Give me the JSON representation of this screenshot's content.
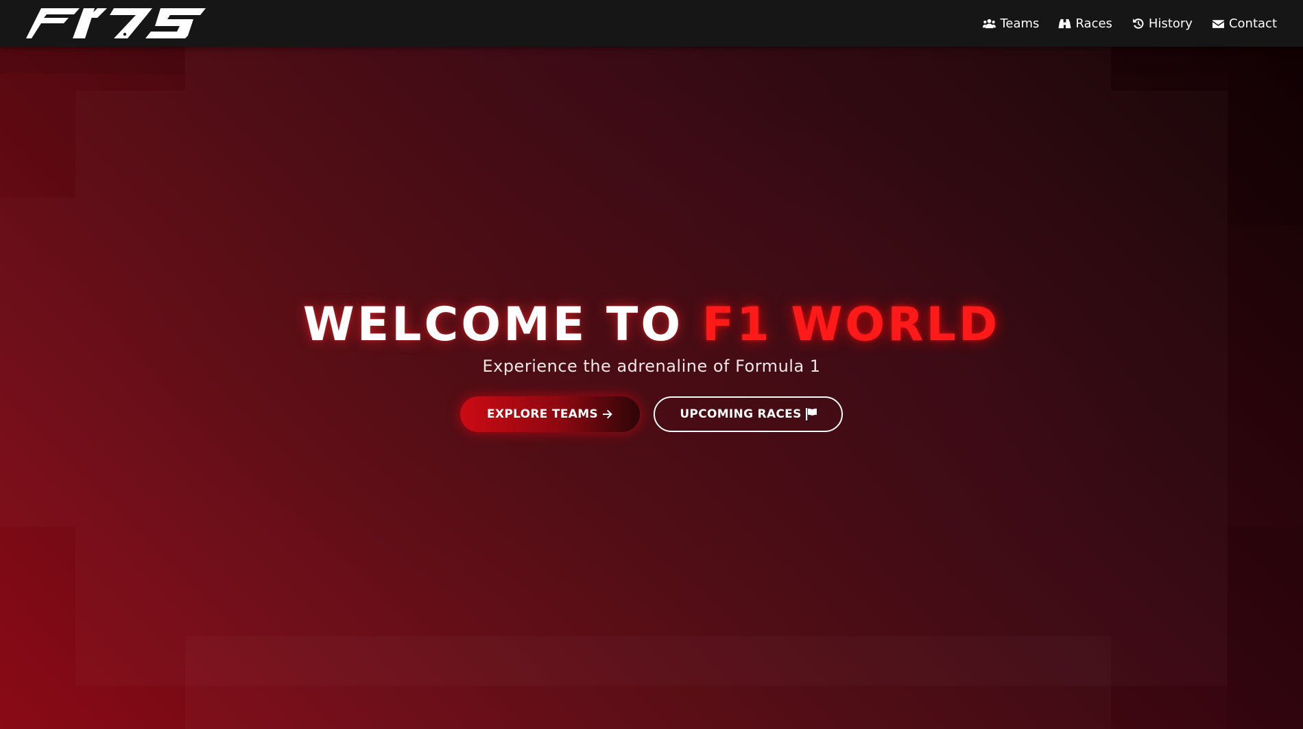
{
  "navbar": {
    "logo_text": "F1 75",
    "links": [
      {
        "label": "Teams",
        "icon": "users-icon"
      },
      {
        "label": "Races",
        "icon": "binoculars-icon"
      },
      {
        "label": "History",
        "icon": "history-icon"
      },
      {
        "label": "Contact",
        "icon": "envelope-icon"
      }
    ]
  },
  "hero": {
    "title_main": "WELCOME TO ",
    "title_accent": "F1 WORLD",
    "subtitle": "Experience the adrenaline of Formula 1",
    "primary_button": {
      "label": "EXPLORE TEAMS",
      "icon": "arrow-right-icon"
    },
    "secondary_button": {
      "label": "UPCOMING RACES",
      "icon": "flag-icon"
    }
  },
  "colors": {
    "navbar_bg": "#161616",
    "accent": "#ff1a1a",
    "hero_dark": "#120204",
    "hero_red": "#8a0a16"
  }
}
